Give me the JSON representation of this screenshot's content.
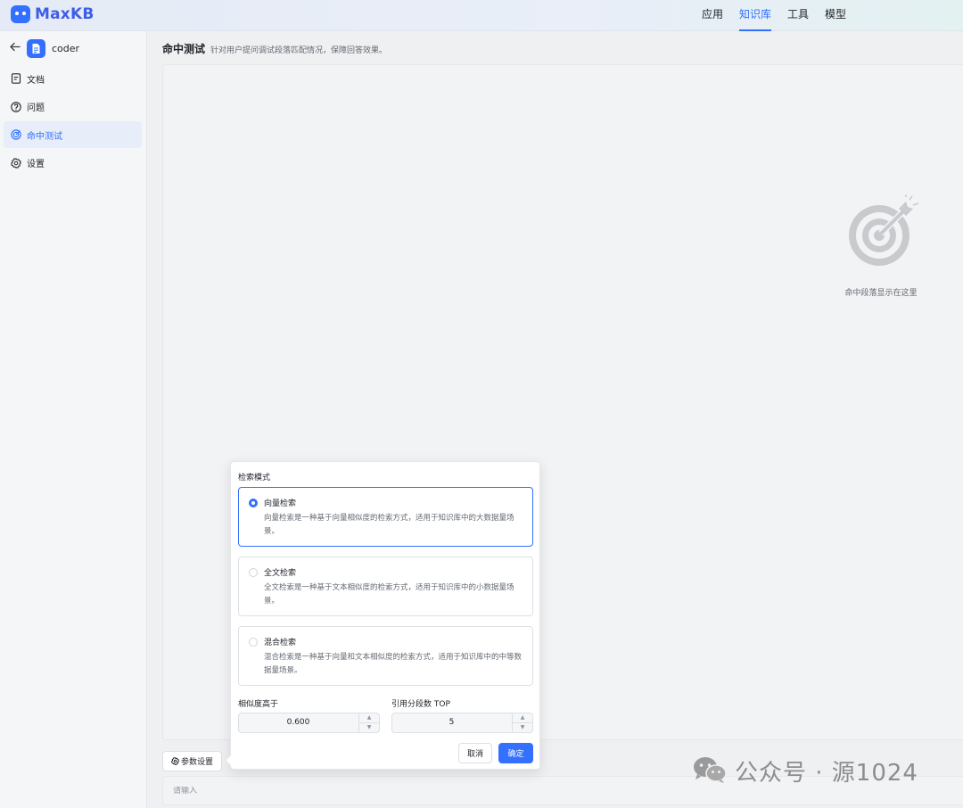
{
  "header": {
    "logo_text": "MaxKB",
    "nav": [
      {
        "label": "应用",
        "active": false
      },
      {
        "label": "知识库",
        "active": true
      },
      {
        "label": "工具",
        "active": false
      },
      {
        "label": "模型",
        "active": false
      }
    ]
  },
  "sidebar": {
    "kb_name": "coder",
    "items": [
      {
        "label": "文档",
        "icon": "document-icon",
        "active": false
      },
      {
        "label": "问题",
        "icon": "question-icon",
        "active": false
      },
      {
        "label": "命中测试",
        "icon": "target-icon",
        "active": true
      },
      {
        "label": "设置",
        "icon": "gear-icon",
        "active": false
      }
    ]
  },
  "main": {
    "title": "命中测试",
    "description": "针对用户提问调试段落匹配情况，保障回答效果。",
    "empty_text": "命中段落显示在这里",
    "param_button_label": "参数设置",
    "input_placeholder": "请输入"
  },
  "popover": {
    "title": "检索模式",
    "modes": [
      {
        "name": "向量检索",
        "desc": "向量检索是一种基于向量相似度的检索方式，适用于知识库中的大数据量场景。",
        "selected": true
      },
      {
        "name": "全文检索",
        "desc": "全文检索是一种基于文本相似度的检索方式，适用于知识库中的小数据量场景。",
        "selected": false
      },
      {
        "name": "混合检索",
        "desc": "混合检索是一种基于向量和文本相似度的检索方式，适用于知识库中的中等数据量场景。",
        "selected": false
      }
    ],
    "similarity_label": "相似度高于",
    "similarity_value": "0.600",
    "top_label": "引用分段数 TOP",
    "top_value": "5",
    "cancel_label": "取消",
    "ok_label": "确定"
  },
  "watermark": {
    "text": "公众号 · 源1024"
  },
  "colors": {
    "accent": "#3370ff",
    "logo": "#3d5ee8"
  }
}
